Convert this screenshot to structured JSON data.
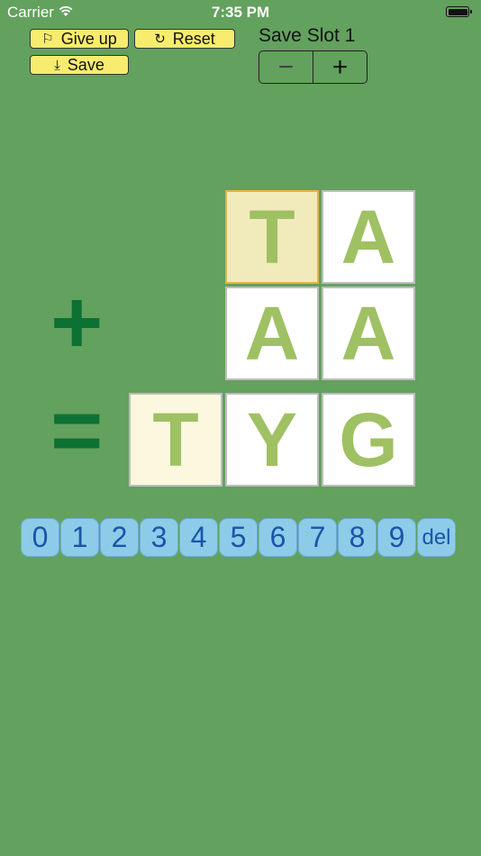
{
  "status": {
    "carrier": "Carrier",
    "time": "7:35 PM"
  },
  "toolbar": {
    "giveup_label": "Give up",
    "reset_label": "Reset",
    "save_label": "Save"
  },
  "slot": {
    "label": "Save Slot 1",
    "minus": "−",
    "plus": "+"
  },
  "puzzle": {
    "row1": [
      "T",
      "A"
    ],
    "row2": [
      "A",
      "A"
    ],
    "result": [
      "T",
      "Y",
      "G"
    ],
    "plus_sign": "+",
    "equals_sign": "="
  },
  "keypad": [
    "0",
    "1",
    "2",
    "3",
    "4",
    "5",
    "6",
    "7",
    "8",
    "9",
    "del"
  ],
  "colors": {
    "background": "#63a15e",
    "button": "#f7ec6e",
    "letters": "#9fc063",
    "operators": "#0d7134",
    "keys": "#8ecbe9"
  }
}
